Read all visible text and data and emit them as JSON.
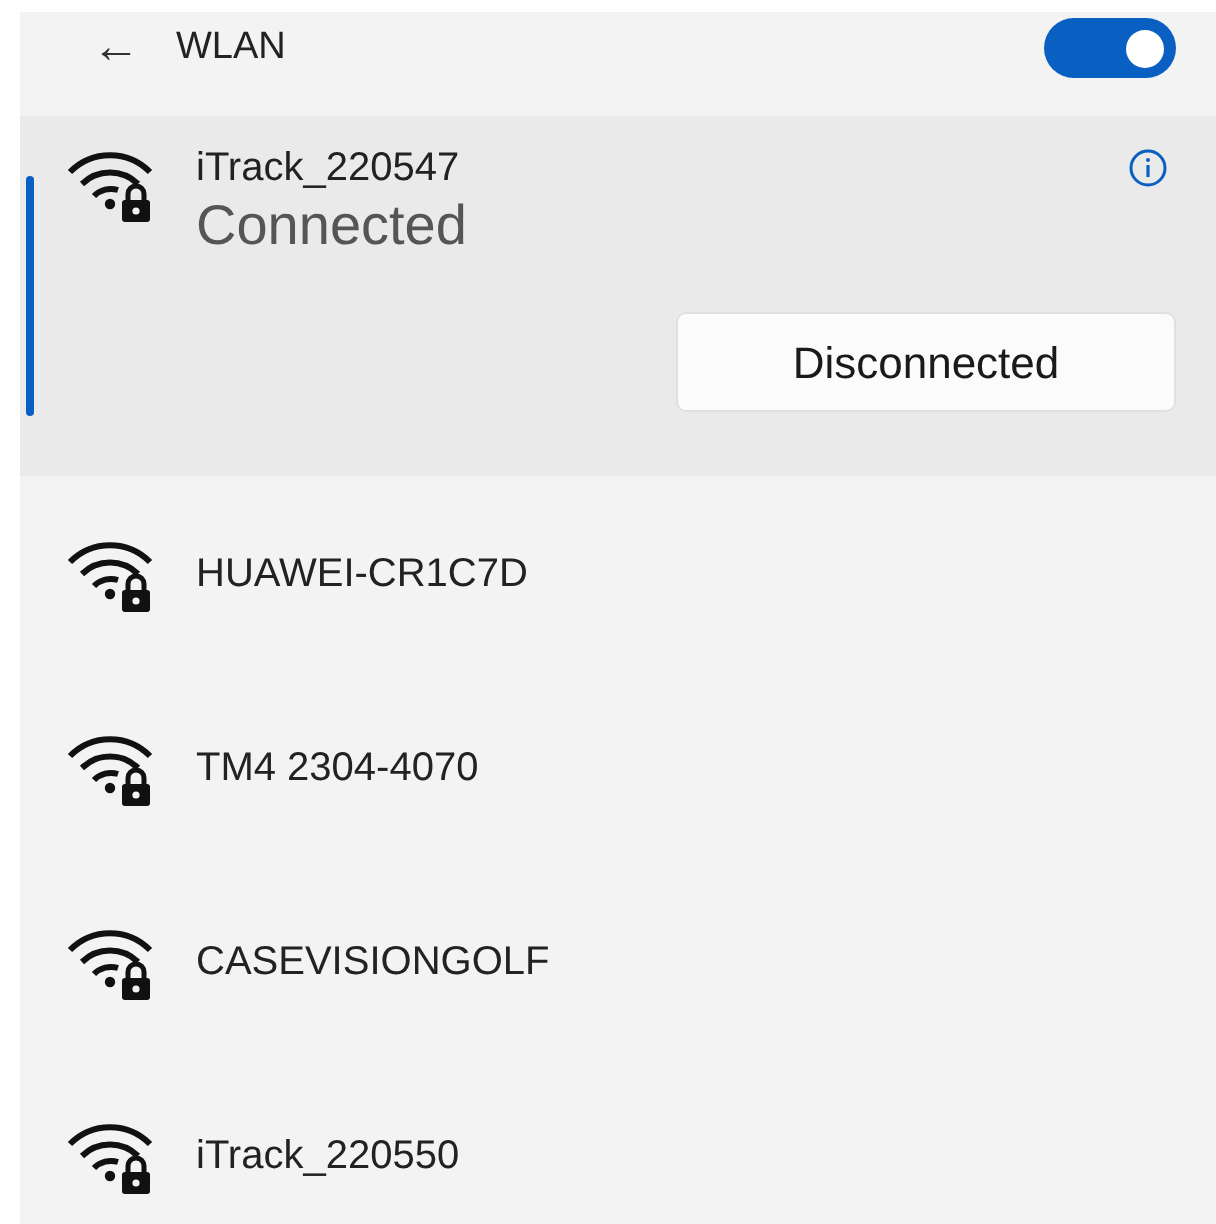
{
  "header": {
    "back": "←",
    "title": "WLAN",
    "wifi_on": true
  },
  "networks": [
    {
      "name": "iTrack_220547",
      "selected": true,
      "status": "Connected",
      "action": "Disconnected"
    },
    {
      "name": "HUAWEI-CR1C7D",
      "selected": false
    },
    {
      "name": "TM4 2304-4070",
      "selected": false
    },
    {
      "name": "CASEVISIONGOLF",
      "selected": false
    },
    {
      "name": "iTrack_220550",
      "selected": false
    }
  ]
}
